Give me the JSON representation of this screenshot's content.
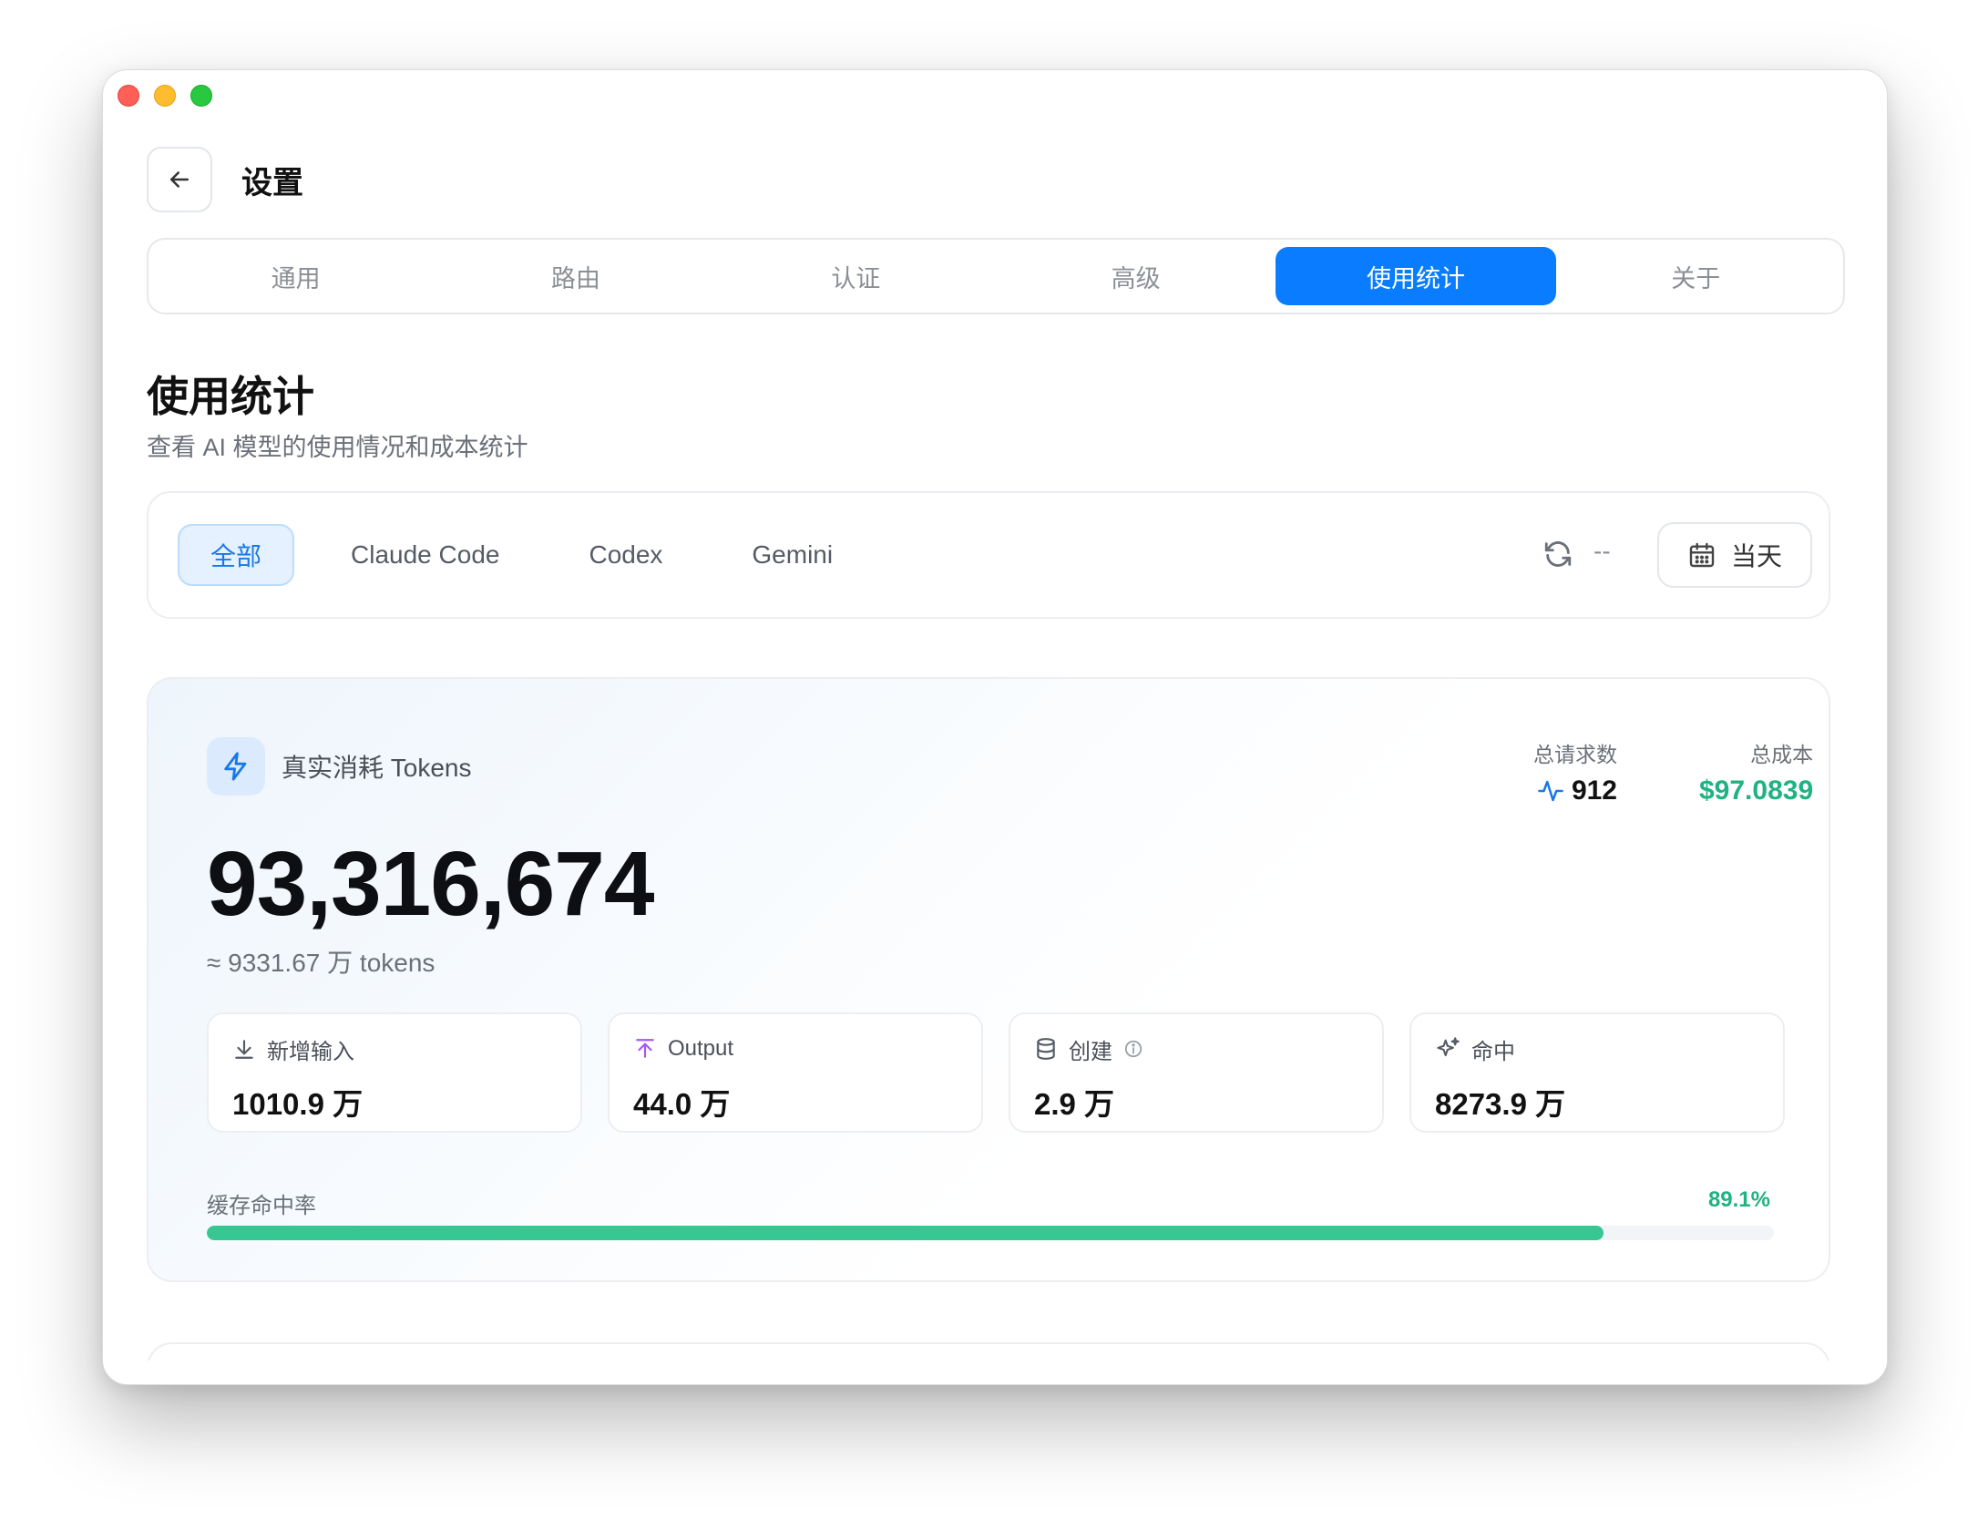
{
  "header": {
    "title": "设置"
  },
  "tabs": [
    {
      "label": "通用"
    },
    {
      "label": "路由"
    },
    {
      "label": "认证"
    },
    {
      "label": "高级"
    },
    {
      "label": "使用统计",
      "active": true
    },
    {
      "label": "关于"
    }
  ],
  "section": {
    "title": "使用统计",
    "subtitle": "查看 AI 模型的使用情况和成本统计"
  },
  "filters": {
    "chips": [
      {
        "label": "全部",
        "active": true
      },
      {
        "label": "Claude Code"
      },
      {
        "label": "Codex"
      },
      {
        "label": "Gemini"
      }
    ],
    "refresh_status": "--",
    "date_range": "当天"
  },
  "summary": {
    "label": "真实消耗 Tokens",
    "total_tokens": "93,316,674",
    "approx": "≈ 9331.67 万 tokens",
    "requests": {
      "label": "总请求数",
      "value": "912"
    },
    "cost": {
      "label": "总成本",
      "value": "$97.0839"
    },
    "breakdown": [
      {
        "label": "新增输入",
        "value": "1010.9 万",
        "icon": "download-icon"
      },
      {
        "label": "Output",
        "value": "44.0 万",
        "icon": "upload-icon"
      },
      {
        "label": "创建",
        "value": "2.9 万",
        "icon": "database-icon"
      },
      {
        "label": "命中",
        "value": "8273.9 万",
        "icon": "sparkles-icon"
      }
    ],
    "cache_rate": {
      "label": "缓存命中率",
      "value": "89.1%",
      "fraction": 0.891
    }
  },
  "colors": {
    "accent": "#0a7cff",
    "success": "#1fb282",
    "progress": "#36c793",
    "output_icon": "#a855f7"
  }
}
